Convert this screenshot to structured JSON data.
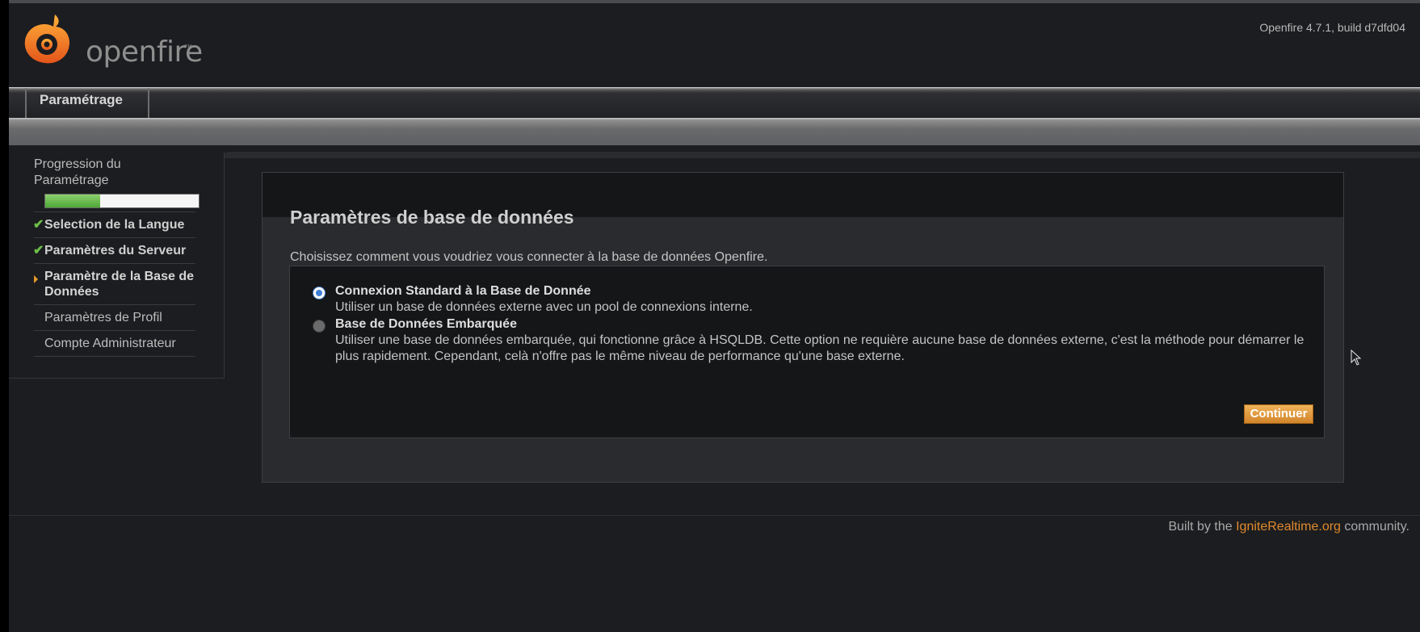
{
  "header": {
    "logo_text": "openfire",
    "logo_tm": "™",
    "version": "Openfire 4.7.1, build d7dfd04"
  },
  "tabs": [
    {
      "label": "Paramétrage"
    }
  ],
  "sidebar": {
    "progress_title": "Progression du Paramétrage",
    "progress_fraction": 0.36,
    "items": [
      {
        "label": "Selection de la Langue",
        "state": "done"
      },
      {
        "label": "Paramètres du Serveur",
        "state": "done"
      },
      {
        "label": "Paramètre de la Base de Données",
        "state": "current"
      },
      {
        "label": "Paramètres de Profil",
        "state": "todo"
      },
      {
        "label": "Compte Administrateur",
        "state": "todo"
      }
    ]
  },
  "main": {
    "title": "Paramètres de base de données",
    "intro": "Choisissez comment vous voudriez vous connecter à la base de données Openfire.",
    "options": [
      {
        "title": "Connexion Standard à la Base de Donnée",
        "description": "Utiliser un base de données externe avec un pool de connexions interne.",
        "selected": true
      },
      {
        "title": "Base de Données Embarquée",
        "description": "Utiliser une base de données embarquée, qui fonctionne grâce à HSQLDB. Cette option ne requière aucune base de données externe, c'est la méthode pour démarrer le plus rapidement. Cependant, celà n'offre pas le même niveau de performance qu'une base externe.",
        "selected": false
      }
    ],
    "continue_label": "Continuer"
  },
  "footer": {
    "prefix": "Built by the ",
    "link_text": "IgniteRealtime.org",
    "suffix": " community."
  },
  "colors": {
    "accent": "#e08a2c",
    "progress_fill": "#5bb040",
    "background": "#1c1d20"
  }
}
